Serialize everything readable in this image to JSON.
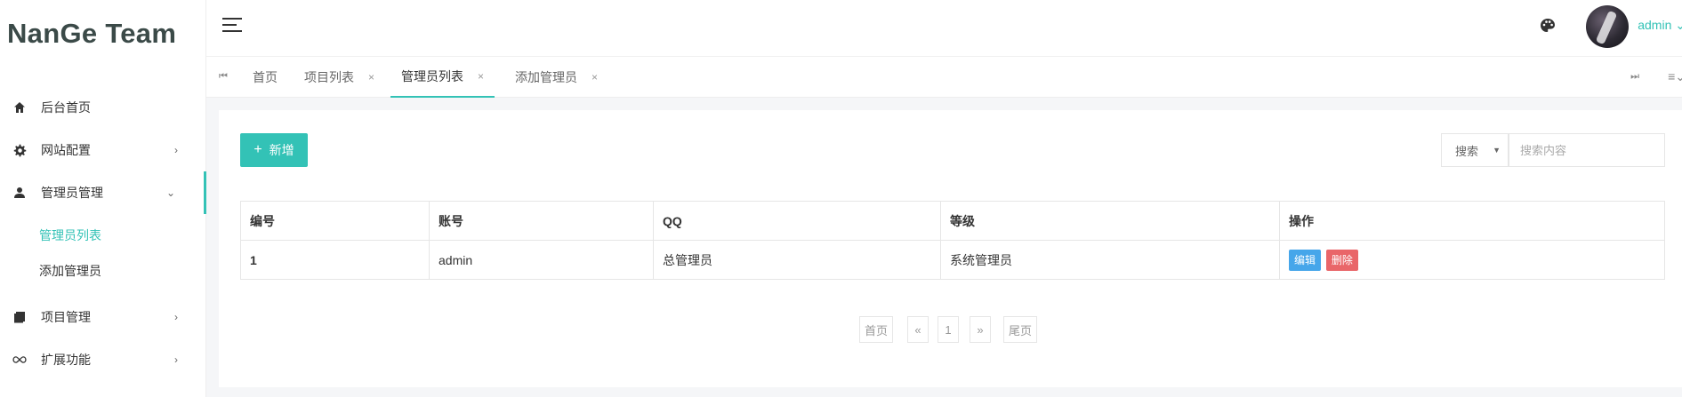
{
  "brand": "NanGe Team",
  "sidebar": {
    "items": [
      {
        "label": "后台首页",
        "icon": "home-icon"
      },
      {
        "label": "网站配置",
        "icon": "gear-icon"
      },
      {
        "label": "管理员管理",
        "icon": "user-icon"
      },
      {
        "label": "项目管理",
        "icon": "book-icon"
      },
      {
        "label": "扩展功能",
        "icon": "infinity-icon"
      }
    ],
    "subitems": [
      {
        "label": "管理员列表"
      },
      {
        "label": "添加管理员"
      }
    ]
  },
  "header": {
    "user": "admin"
  },
  "tabs": [
    {
      "label": "首页"
    },
    {
      "label": "项目列表"
    },
    {
      "label": "管理员列表"
    },
    {
      "label": "添加管理员"
    }
  ],
  "toolbar": {
    "add_label": "新增",
    "search_select": "搜索",
    "search_placeholder": "搜索内容"
  },
  "table": {
    "columns": [
      "编号",
      "账号",
      "QQ",
      "等级",
      "操作"
    ],
    "rows": [
      {
        "id": "1",
        "account": "admin",
        "qq": "总管理员",
        "level": "系统管理员",
        "edit": "编辑",
        "delete": "删除"
      }
    ]
  },
  "pagination": {
    "first": "首页",
    "prev": "«",
    "current": "1",
    "next": "»",
    "last": "尾页"
  },
  "colors": {
    "accent": "#33c2b6",
    "edit": "#46a6ea",
    "delete": "#e96669"
  }
}
